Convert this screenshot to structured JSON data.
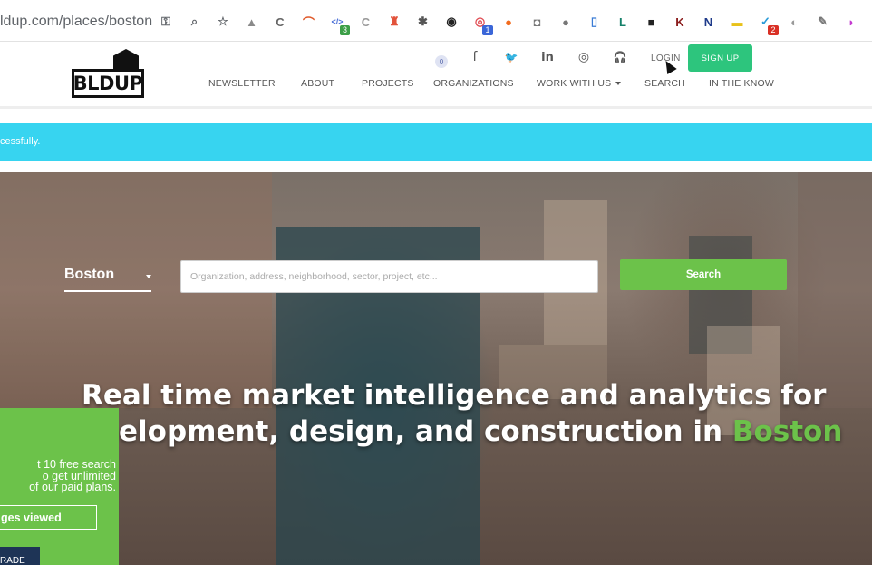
{
  "browser": {
    "url": "ldup.com/places/boston",
    "extensions": [
      {
        "name": "key-icon",
        "glyph": "⚿",
        "color": "#5f6368"
      },
      {
        "name": "zoom-icon",
        "glyph": "⌕",
        "color": "#5f6368"
      },
      {
        "name": "star-icon",
        "glyph": "☆",
        "color": "#5f6368"
      },
      {
        "name": "drive-icon",
        "glyph": "▲",
        "color": "#8a8a8a"
      },
      {
        "name": "c-box-icon",
        "glyph": "C",
        "color": "#666"
      },
      {
        "name": "arc-icon",
        "glyph": "⌒",
        "color": "#e05a2b"
      },
      {
        "name": "code-ext-icon",
        "glyph": "</>",
        "color": "#4a6fd6",
        "badge": "3",
        "badge_color": "#3c9f48"
      },
      {
        "name": "c-outline-icon",
        "glyph": "C",
        "color": "#999"
      },
      {
        "name": "lighthouse-icon",
        "glyph": "♜",
        "color": "#e2533b"
      },
      {
        "name": "hubspot-icon",
        "glyph": "✱",
        "color": "#555"
      },
      {
        "name": "owl-icon",
        "glyph": "◉",
        "color": "#222"
      },
      {
        "name": "target-icon",
        "glyph": "◎",
        "color": "#e04b52",
        "badge": "1",
        "badge_color": "#3a66d8"
      },
      {
        "name": "orange-ext-icon",
        "glyph": "●",
        "color": "#f26b1d"
      },
      {
        "name": "camera-icon",
        "glyph": "◘",
        "color": "#777"
      },
      {
        "name": "gray-circle-icon",
        "glyph": "●",
        "color": "#777"
      },
      {
        "name": "blue-box-icon",
        "glyph": "▯",
        "color": "#3a7bd5"
      },
      {
        "name": "l-box-icon",
        "glyph": "L",
        "color": "#14806a"
      },
      {
        "name": "video-icon",
        "glyph": "■",
        "color": "#222"
      },
      {
        "name": "k-circle-icon",
        "glyph": "K",
        "color": "#8b1d1d"
      },
      {
        "name": "n-box-icon",
        "glyph": "N",
        "color": "#1e3a8a"
      },
      {
        "name": "yellow-box-icon",
        "glyph": "▬",
        "color": "#e8c21a"
      },
      {
        "name": "check-ext-icon",
        "glyph": "✓",
        "color": "#2a9bd8",
        "badge": "2",
        "badge_color": "#d93025"
      },
      {
        "name": "gray-dots-icon",
        "glyph": "◐",
        "color": "#999"
      },
      {
        "name": "notebook-icon",
        "glyph": "✎",
        "color": "#777"
      },
      {
        "name": "pink-ext-icon",
        "glyph": "◗",
        "color": "#c43bd0"
      }
    ]
  },
  "header": {
    "logo_text": "BLDUP",
    "cart_count": "0",
    "social": [
      {
        "name": "facebook-icon",
        "glyph": "f"
      },
      {
        "name": "twitter-icon",
        "glyph": "🐦"
      },
      {
        "name": "linkedin-icon",
        "glyph": "in"
      },
      {
        "name": "instagram-icon",
        "glyph": "◎"
      },
      {
        "name": "podcast-icon",
        "glyph": "🎧"
      }
    ],
    "login": "LOGIN",
    "signup": "SIGN UP",
    "nav": [
      "NEWSLETTER",
      "ABOUT",
      "PROJECTS",
      "ORGANIZATIONS",
      "WORK WITH US",
      "SEARCH",
      "IN THE KNOW"
    ]
  },
  "banner": {
    "text": "cessfully."
  },
  "hero": {
    "city": "Boston",
    "search_placeholder": "Organization, address, neighborhood, sector, project, etc...",
    "search_button": "Search",
    "headline_line1": "Real time market intelligence and analytics for",
    "headline_line2_prefix": "elopment, design, and construction in ",
    "headline_city": "Boston"
  },
  "promo": {
    "line1": "t 10 free search",
    "line2": "o get unlimited",
    "line3": "of our paid plans.",
    "pages_viewed": "ges viewed",
    "upgrade": "RADE"
  },
  "colors": {
    "accent_green": "#6cc24a",
    "signup_green": "#2dc57d",
    "banner_cyan": "#37d4f0",
    "upgrade_navy": "#1e3456"
  }
}
